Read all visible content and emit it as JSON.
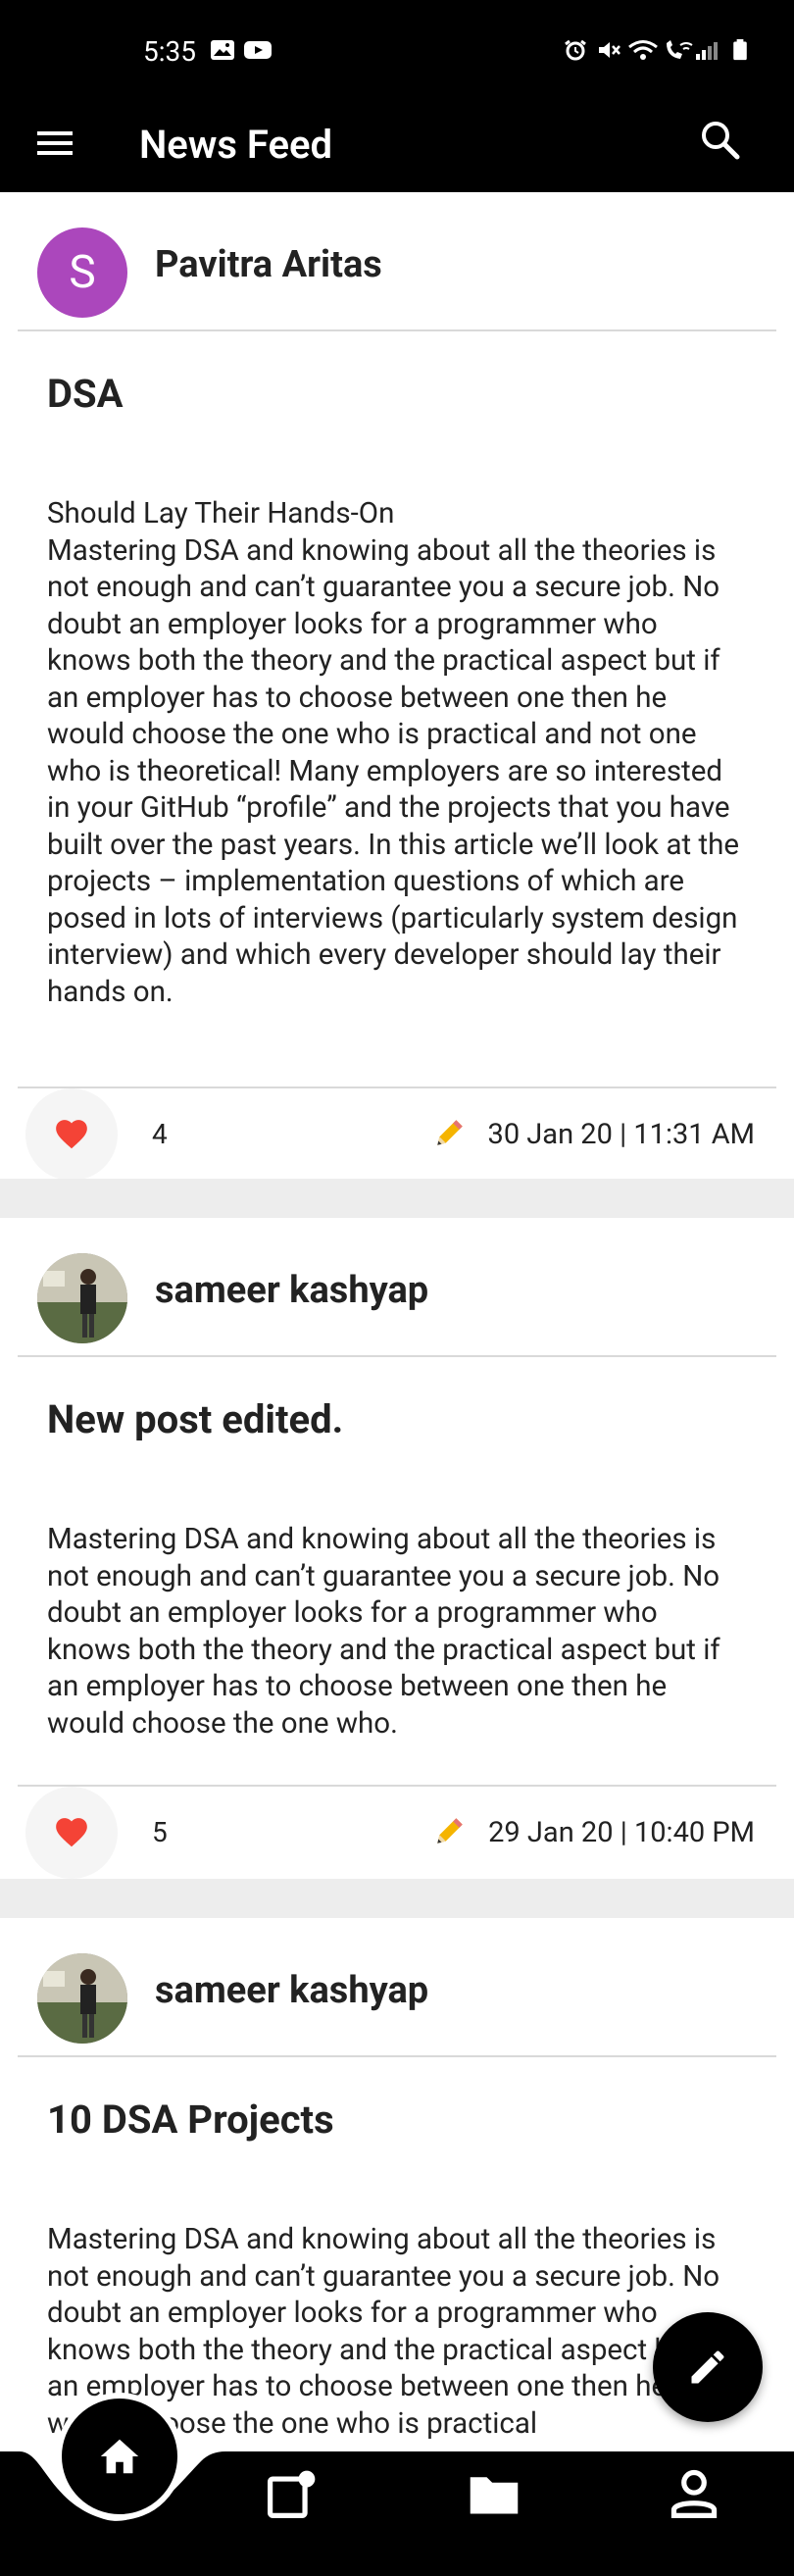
{
  "status_bar": {
    "time": "5:35",
    "left_icons": [
      "image-icon",
      "youtube-icon"
    ],
    "right_icons": [
      "alarm-icon",
      "mute-icon",
      "wifi-icon",
      "wifi-calling-icon",
      "signal-icon",
      "battery-icon"
    ]
  },
  "app_bar": {
    "title": "News Feed",
    "menu_icon": "menu-icon",
    "search_icon": "search-icon"
  },
  "posts": [
    {
      "author": "Pavitra Aritas",
      "avatar_letter": "S",
      "avatar_color": "#ab47bc",
      "title": "DSA",
      "body": "Should Lay Their Hands-On\nMastering DSA and knowing about all the theories is not enough and can’t guarantee you a secure job. No doubt an employer looks for a programmer who knows both the theory and the practical aspect but if an employer has to choose between one then he would choose the one who is practical and not one who is theoretical! Many employers are so interested in your GitHub “profile” and the projects that you have built over the past years. In this article we’ll look at the projects – implementation questions of which are posed in lots of interviews (particularly system design interview) and which every developer should lay their hands on.",
      "likes": "4",
      "date": "30 Jan 20 | 11:31 AM"
    },
    {
      "author": "sameer kashyap",
      "title": "New post edited.",
      "body": "Mastering DSA and knowing about all the theories is not enough and can’t guarantee you a secure job. No doubt an employer looks for a programmer who knows both the theory and the practical aspect but if an employer has to choose between one then he would choose the one who.",
      "likes": "5",
      "date": "29 Jan 20 | 10:40 PM"
    },
    {
      "author": "sameer kashyap",
      "title": "10 DSA Projects",
      "body": "Mastering DSA and knowing about all the theories is not enough and can’t guarantee you a secure job. No doubt an employer looks for a programmer who knows both the theory and the practical aspect but if an employer has to choose between one then he would choose the one who is practical"
    }
  ],
  "fab": {
    "icon": "edit-pencil-icon"
  },
  "bottom_nav": {
    "items": [
      {
        "icon": "home-icon",
        "active": true
      },
      {
        "icon": "new-post-icon"
      },
      {
        "icon": "folder-icon"
      },
      {
        "icon": "person-icon"
      }
    ]
  },
  "colors": {
    "accent": "#000000",
    "like": "#f44336",
    "avatar_purple": "#ab47bc"
  }
}
